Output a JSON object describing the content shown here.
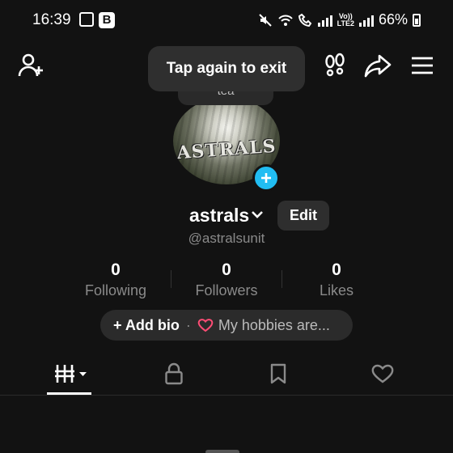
{
  "status_bar": {
    "time": "16:39",
    "battery_text": "66%",
    "volte_line1": "Vo))",
    "volte_line2": "LTE2",
    "icons": [
      "gallery-icon",
      "b-icon",
      "mute-icon",
      "wifi-icon",
      "wifi-calling-icon",
      "signal-icon",
      "battery-icon"
    ]
  },
  "header": {
    "icons": [
      "add-user-icon",
      "footprints-icon",
      "share-icon",
      "menu-icon"
    ]
  },
  "toast": {
    "text": "Tap again to exit"
  },
  "tea_pill": {
    "text": "tea"
  },
  "avatar": {
    "text": "ASTRALS",
    "add_badge_color": "#21bdf2"
  },
  "profile": {
    "username": "astrals",
    "edit_label": "Edit",
    "handle": "@astralsunit"
  },
  "stats": [
    {
      "value": "0",
      "label": "Following"
    },
    {
      "value": "0",
      "label": "Followers"
    },
    {
      "value": "0",
      "label": "Likes"
    }
  ],
  "bio": {
    "add_label": "+ Add bio",
    "separator": "·",
    "hobbies_label": "My hobbies are...",
    "heart_color": "#ff4d75"
  },
  "tabs": [
    {
      "icon": "videos-grid-icon",
      "active": true
    },
    {
      "icon": "lock-icon",
      "active": false
    },
    {
      "icon": "bookmark-icon",
      "active": false
    },
    {
      "icon": "heart-icon",
      "active": false
    }
  ]
}
